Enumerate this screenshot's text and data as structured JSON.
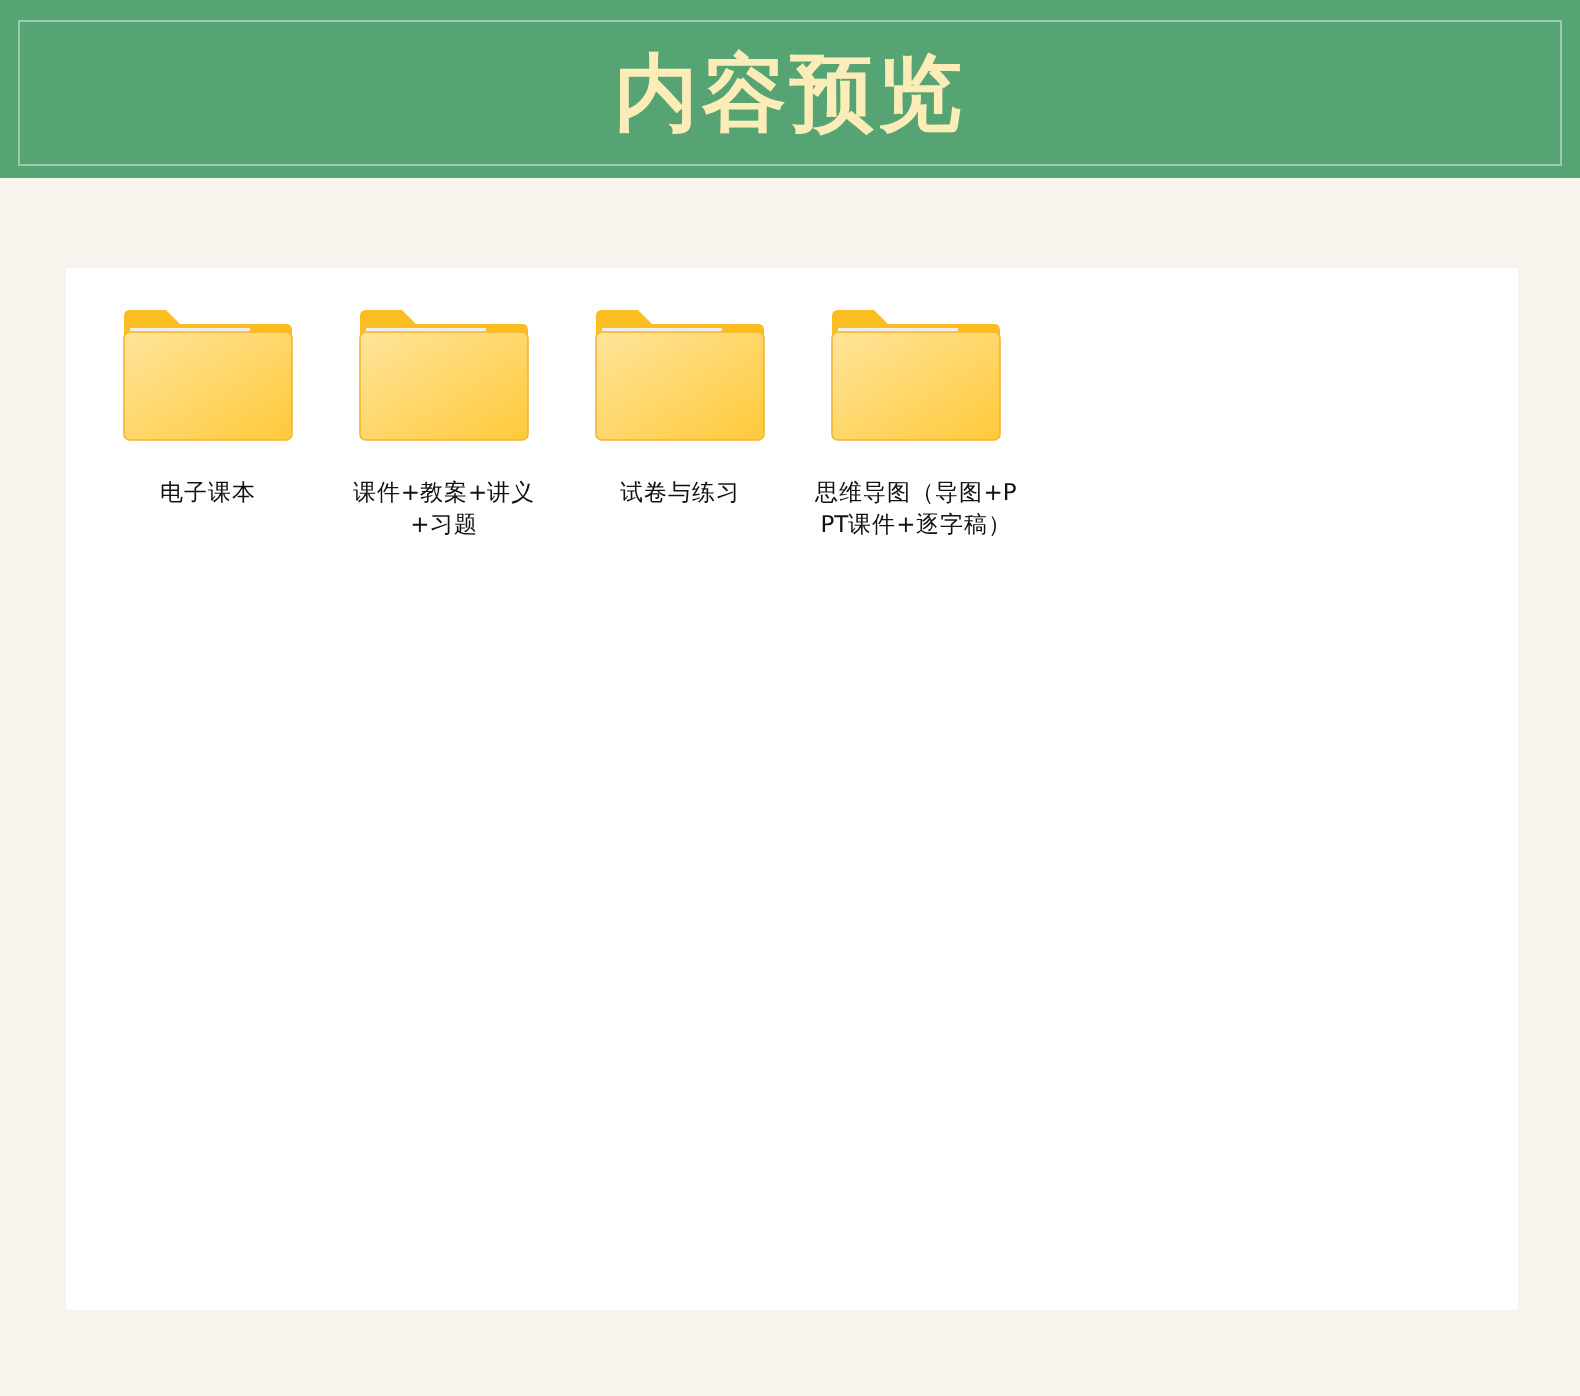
{
  "header": {
    "title": "内容预览"
  },
  "folders": [
    {
      "name": "电子课本"
    },
    {
      "name": "课件+教案+讲义+习题"
    },
    {
      "name": "试卷与练习"
    },
    {
      "name": "思维导图（导图+PPT课件+逐字稿）"
    }
  ]
}
